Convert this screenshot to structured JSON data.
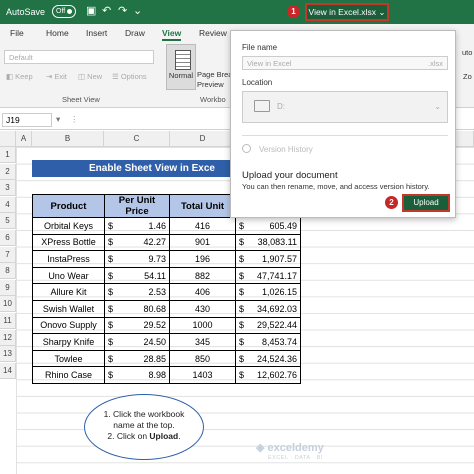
{
  "titlebar": {
    "autosave": "AutoSave",
    "toggle": "Off",
    "file_name": "View in Excel.xlsx",
    "caret": "⌄",
    "badge1": "1",
    "badge2": "2"
  },
  "tabs": [
    "File",
    "Home",
    "Insert",
    "Draw",
    "View",
    "Review"
  ],
  "ribbon": {
    "sheet_default": "Default",
    "keep": "Keep",
    "exit": "Exit",
    "new": "New",
    "options": "Options",
    "group_sheet_view": "Sheet View",
    "normal": "Normal",
    "page_break_1": "Page Brea",
    "page_break_2": "Preview",
    "group_workbook": "Workbo",
    "right_edge_1": "uto",
    "right_edge_2": "Zo"
  },
  "formula_bar": {
    "cell": "J19"
  },
  "columns": [
    "A",
    "B",
    "C",
    "D"
  ],
  "rows": [
    "1",
    "2",
    "3",
    "4",
    "5",
    "6",
    "7",
    "8",
    "9",
    "10",
    "11",
    "12",
    "13",
    "14"
  ],
  "banner": "Enable Sheet View in Exce",
  "table": {
    "headers": [
      "Product",
      "Per Unit Price",
      "Total Unit",
      ""
    ],
    "currency": "$",
    "rows": [
      {
        "product": "Orbital Keys",
        "price": "1.46",
        "units": "416",
        "sales": "605.49"
      },
      {
        "product": "XPress Bottle",
        "price": "42.27",
        "units": "901",
        "sales": "38,083.11"
      },
      {
        "product": "InstaPress",
        "price": "9.73",
        "units": "196",
        "sales": "1,907.57"
      },
      {
        "product": "Uno Wear",
        "price": "54.11",
        "units": "882",
        "sales": "47,741.17"
      },
      {
        "product": "Allure Kit",
        "price": "2.53",
        "units": "406",
        "sales": "1,026.15"
      },
      {
        "product": "Swish Wallet",
        "price": "80.68",
        "units": "430",
        "sales": "34,692.03"
      },
      {
        "product": "Onovo Supply",
        "price": "29.52",
        "units": "1000",
        "sales": "29,522.44"
      },
      {
        "product": "Sharpy Knife",
        "price": "24.50",
        "units": "345",
        "sales": "8,453.74"
      },
      {
        "product": "Towlee",
        "price": "28.85",
        "units": "850",
        "sales": "24,524.36"
      },
      {
        "product": "Rhino Case",
        "price": "8.98",
        "units": "1403",
        "sales": "12,602.76"
      }
    ]
  },
  "popup": {
    "file_name_label": "File name",
    "file_name_value": "View in Excel",
    "file_ext": ".xlsx",
    "location_label": "Location",
    "location_value": "D:",
    "version_history": "Version History",
    "upload_title": "Upload your document",
    "upload_desc": "You can then rename, move, and access version history.",
    "upload_button": "Upload"
  },
  "note": {
    "line1": "1. Click the workbook",
    "line2": "name at the top.",
    "line3": "2. Click on ",
    "line3_bold": "Upload",
    "line3_end": "."
  },
  "watermark": {
    "brand": "exceldemy",
    "tagline": "EXCEL · DATA · BI"
  }
}
